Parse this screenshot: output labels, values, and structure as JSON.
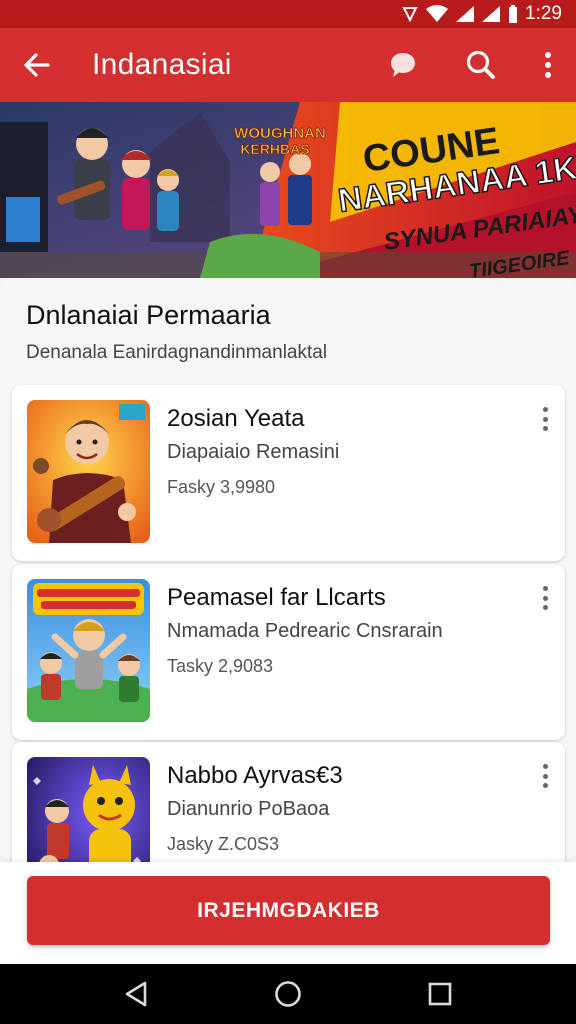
{
  "status_bar": {
    "time": "1:29"
  },
  "app_bar": {
    "title": "Indanasiai"
  },
  "banner": {
    "logo_text": [
      "WOUGHNAN",
      "KERHBAS"
    ],
    "headline": [
      "COUNE",
      "NARHANAA 1K"
    ],
    "subline": [
      "SYNUA PARIAIAY",
      "TIIGEOIRE"
    ]
  },
  "section": {
    "title": "Dnlanaiai Permaaria",
    "subtitle": "Denanala Eanirdagnandinmanlaktal"
  },
  "apps": [
    {
      "name": "2osian Yeata",
      "developer": "Diapaiaio Remasini",
      "meta": "Fasky 3,9980",
      "colors": {
        "bg": "#f39c12",
        "accent": "#c0392b"
      }
    },
    {
      "name": "Peamasel far Llcarts",
      "developer": "Nmamada Pedrearic Cnsrarain",
      "meta": "Tasky 2,9083",
      "colors": {
        "bg": "#4ba3e3",
        "accent": "#4caf50"
      }
    },
    {
      "name": "Nabbo Ayrvas€3",
      "developer": "Dianunrio PoBaoa",
      "meta": "Jasky Z.C0S3",
      "colors": {
        "bg": "#3a2a8c",
        "accent": "#f4c20d"
      }
    }
  ],
  "primary_button": {
    "label": "IRJEHMGDAKIEB"
  },
  "theme": {
    "primary": "#d32f2f",
    "primary_dark": "#b71c1c"
  },
  "icons": [
    "back-arrow-icon",
    "chat-bubble-icon",
    "search-icon",
    "more-vert-icon",
    "nav-back-icon",
    "nav-home-icon",
    "nav-recents-icon"
  ]
}
